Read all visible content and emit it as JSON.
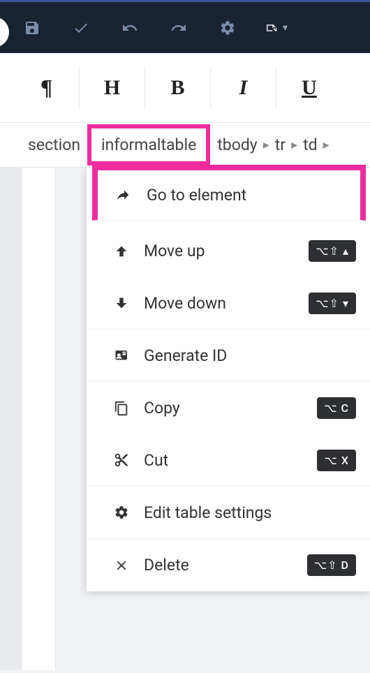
{
  "toolbar": {
    "save": "save",
    "check": "check",
    "undo": "undo",
    "redo": "redo",
    "settings": "settings",
    "fullscreen": "fullscreen"
  },
  "format": {
    "pilcrow": "¶",
    "heading": "H",
    "bold": "B",
    "italic": "I",
    "underline": "U"
  },
  "breadcrumb": {
    "items": [
      "section",
      "informaltable",
      "tbody",
      "tr",
      "td"
    ]
  },
  "menu": {
    "go_to": "Go to element",
    "move_up": "Move up",
    "move_down": "Move down",
    "gen_id": "Generate ID",
    "copy": "Copy",
    "cut": "Cut",
    "edit_table": "Edit table settings",
    "delete": "Delete",
    "sc_move_up": "⌥⇧ ▴",
    "sc_move_down": "⌥⇧ ▾",
    "sc_copy": "⌥ C",
    "sc_cut": "⌥ X",
    "sc_delete": "⌥⇧ D"
  }
}
